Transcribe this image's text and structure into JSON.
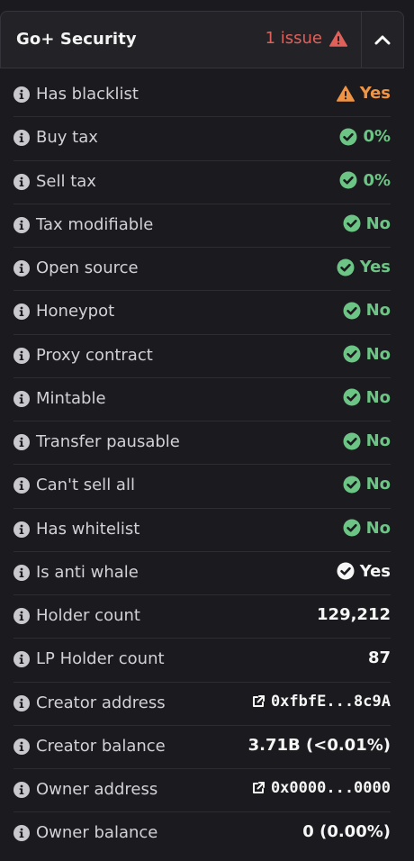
{
  "header": {
    "title": "Go+ Security",
    "issue_text": "1 issue"
  },
  "rows": [
    {
      "label": "Has blacklist",
      "value": "Yes",
      "status": "warning"
    },
    {
      "label": "Buy tax",
      "value": "0%",
      "status": "ok"
    },
    {
      "label": "Sell tax",
      "value": "0%",
      "status": "ok"
    },
    {
      "label": "Tax modifiable",
      "value": "No",
      "status": "ok"
    },
    {
      "label": "Open source",
      "value": "Yes",
      "status": "ok"
    },
    {
      "label": "Honeypot",
      "value": "No",
      "status": "ok"
    },
    {
      "label": "Proxy contract",
      "value": "No",
      "status": "ok"
    },
    {
      "label": "Mintable",
      "value": "No",
      "status": "ok"
    },
    {
      "label": "Transfer pausable",
      "value": "No",
      "status": "ok"
    },
    {
      "label": "Can't sell all",
      "value": "No",
      "status": "ok"
    },
    {
      "label": "Has whitelist",
      "value": "No",
      "status": "ok"
    },
    {
      "label": "Is anti whale",
      "value": "Yes",
      "status": "neutral"
    },
    {
      "label": "Holder count",
      "value": "129,212",
      "status": "plain"
    },
    {
      "label": "LP Holder count",
      "value": "87",
      "status": "plain"
    },
    {
      "label": "Creator address",
      "value": "0xfbfE...8c9A",
      "status": "link"
    },
    {
      "label": "Creator balance",
      "value": "3.71B (<0.01%)",
      "status": "plain"
    },
    {
      "label": "Owner address",
      "value": "0x0000...0000",
      "status": "link"
    },
    {
      "label": "Owner balance",
      "value": "0 (0.00%)",
      "status": "plain"
    }
  ],
  "colors": {
    "ok": "#6cc585",
    "warning": "#ef9445",
    "issue": "#e0605a",
    "plain": "#f6f6f6"
  }
}
